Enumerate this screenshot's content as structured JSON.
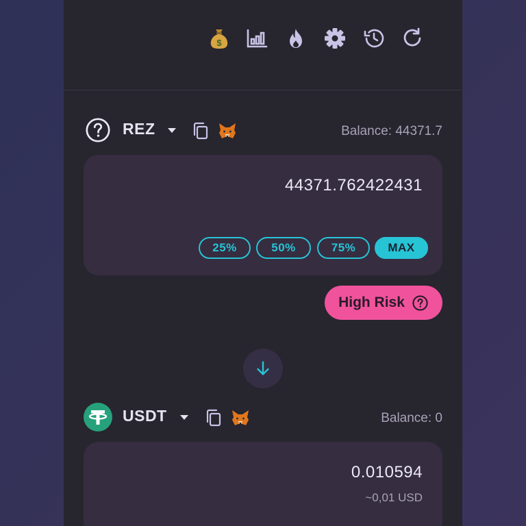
{
  "header": {
    "icons": [
      "money-bag-icon",
      "bar-chart-icon",
      "flame-icon",
      "gear-icon",
      "history-icon",
      "refresh-icon"
    ]
  },
  "from_token": {
    "symbol": "REZ",
    "icon": "question-circle-icon",
    "balance_label": "Balance: 44371.7",
    "amount": "44371.762422431",
    "quick_amounts": [
      "25%",
      "50%",
      "75%",
      "MAX"
    ],
    "risk_label": "High Risk"
  },
  "swap": {
    "icon": "arrow-down-icon"
  },
  "to_token": {
    "symbol": "USDT",
    "icon": "tether-icon",
    "balance_label": "Balance: 0",
    "amount": "0.010594",
    "usd_value": "~0,01 USD"
  },
  "colors": {
    "panel_bg": "#27252e",
    "input_bg": "#362d40",
    "accent_cyan": "#27c4d6",
    "risk_pink": "#f0539b",
    "tether_green": "#26a17b"
  }
}
